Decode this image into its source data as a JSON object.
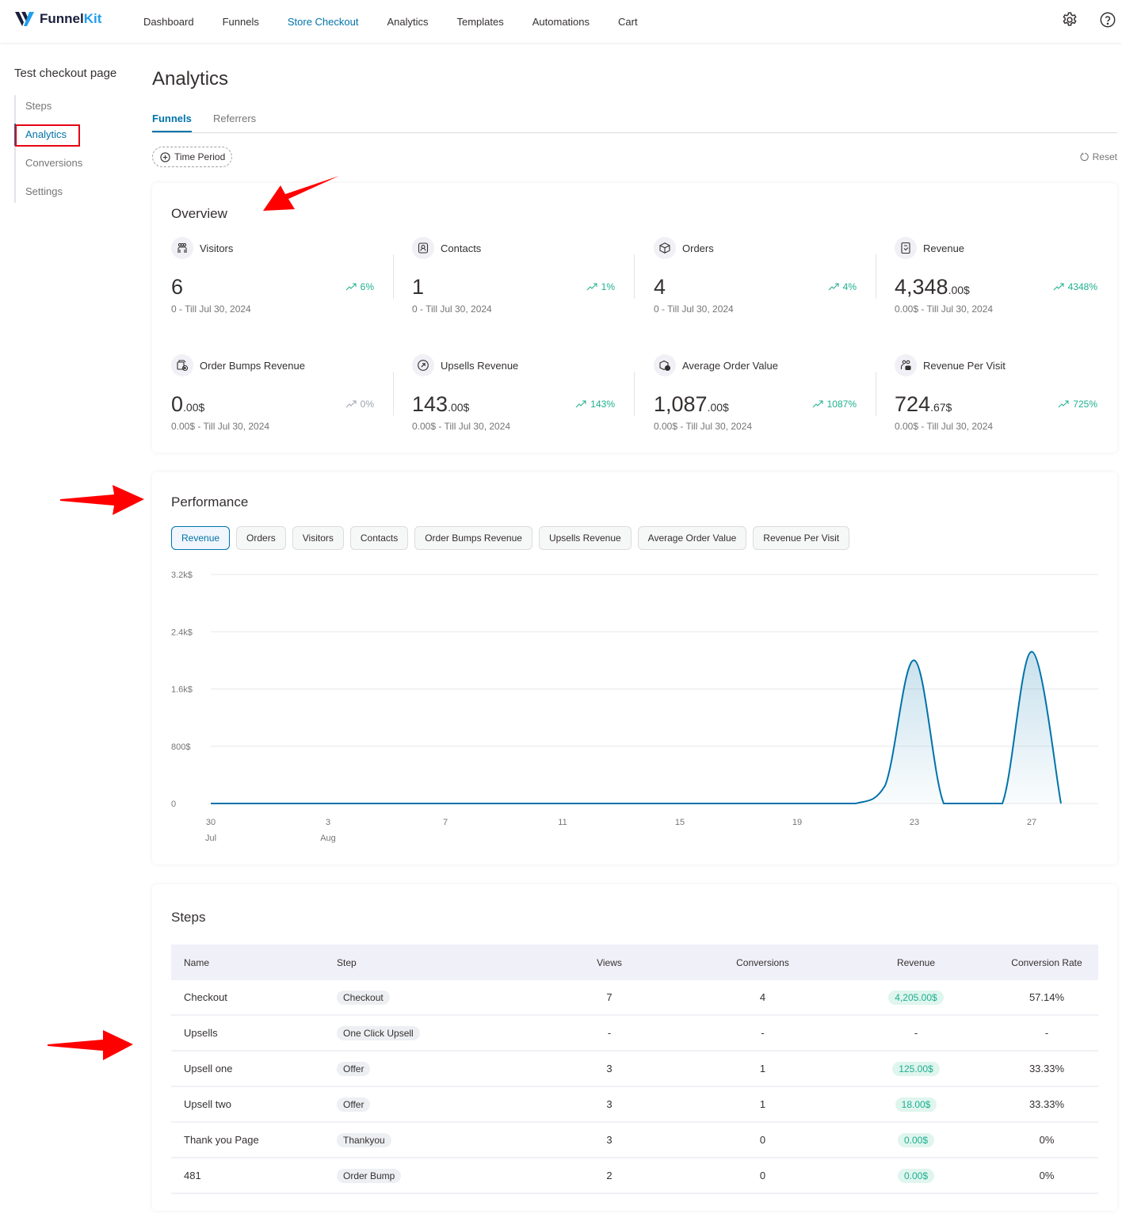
{
  "app": {
    "brand_part1": "Funnel",
    "brand_part2": "Kit",
    "nav": [
      {
        "label": "Dashboard",
        "active": false
      },
      {
        "label": "Funnels",
        "active": false
      },
      {
        "label": "Store Checkout",
        "active": true
      },
      {
        "label": "Analytics",
        "active": false
      },
      {
        "label": "Templates",
        "active": false
      },
      {
        "label": "Automations",
        "active": false
      },
      {
        "label": "Cart",
        "active": false
      }
    ],
    "icons": [
      "gear-icon",
      "help-icon"
    ]
  },
  "sidebar": {
    "title": "Test checkout page",
    "items": [
      {
        "label": "Steps",
        "active": false
      },
      {
        "label": "Analytics",
        "active": true
      },
      {
        "label": "Conversions",
        "active": false
      },
      {
        "label": "Settings",
        "active": false
      }
    ]
  },
  "main": {
    "title": "Analytics",
    "tabs": [
      {
        "label": "Funnels",
        "active": true
      },
      {
        "label": "Referrers",
        "active": false
      }
    ],
    "time_period_label": "Time Period",
    "reset_label": "Reset"
  },
  "overview": {
    "title": "Overview",
    "metrics": [
      {
        "label": "Visitors",
        "icon": "visitors-icon",
        "value": "6",
        "decimal": "",
        "change": "6%",
        "trend": "up",
        "sub": "0 - Till Jul 30, 2024"
      },
      {
        "label": "Contacts",
        "icon": "contacts-icon",
        "value": "1",
        "decimal": "",
        "change": "1%",
        "trend": "up",
        "sub": "0 - Till Jul 30, 2024"
      },
      {
        "label": "Orders",
        "icon": "orders-icon",
        "value": "4",
        "decimal": "",
        "change": "4%",
        "trend": "up",
        "sub": "0 - Till Jul 30, 2024"
      },
      {
        "label": "Revenue",
        "icon": "revenue-icon",
        "value": "4,348",
        "decimal": ".00$",
        "change": "4348%",
        "trend": "up",
        "sub": "0.00$ - Till Jul 30, 2024"
      },
      {
        "label": "Order Bumps Revenue",
        "icon": "order-bumps-icon",
        "value": "0",
        "decimal": ".00$",
        "change": "0%",
        "trend": "neutral",
        "sub": "0.00$ - Till Jul 30, 2024"
      },
      {
        "label": "Upsells Revenue",
        "icon": "upsells-icon",
        "value": "143",
        "decimal": ".00$",
        "change": "143%",
        "trend": "up",
        "sub": "0.00$ - Till Jul 30, 2024"
      },
      {
        "label": "Average Order Value",
        "icon": "aov-icon",
        "value": "1,087",
        "decimal": ".00$",
        "change": "1087%",
        "trend": "up",
        "sub": "0.00$ - Till Jul 30, 2024"
      },
      {
        "label": "Revenue Per Visit",
        "icon": "revenue-per-visit-icon",
        "value": "724",
        "decimal": ".67$",
        "change": "725%",
        "trend": "up",
        "sub": "0.00$ - Till Jul 30, 2024"
      }
    ]
  },
  "performance": {
    "title": "Performance",
    "chips": [
      {
        "label": "Revenue",
        "active": true
      },
      {
        "label": "Orders",
        "active": false
      },
      {
        "label": "Visitors",
        "active": false
      },
      {
        "label": "Contacts",
        "active": false
      },
      {
        "label": "Order Bumps Revenue",
        "active": false
      },
      {
        "label": "Upsells Revenue",
        "active": false
      },
      {
        "label": "Average Order Value",
        "active": false
      },
      {
        "label": "Revenue Per Visit",
        "active": false
      }
    ]
  },
  "chart_data": {
    "type": "area",
    "title": "",
    "xlabel": "",
    "ylabel": "",
    "series": [
      {
        "name": "Revenue",
        "color": "#0073aa",
        "x": [
          "Jul 30",
          "Jul 31",
          "Aug 1",
          "Aug 2",
          "Aug 3",
          "Aug 4",
          "Aug 5",
          "Aug 6",
          "Aug 7",
          "Aug 8",
          "Aug 9",
          "Aug 10",
          "Aug 11",
          "Aug 12",
          "Aug 13",
          "Aug 14",
          "Aug 15",
          "Aug 16",
          "Aug 17",
          "Aug 18",
          "Aug 19",
          "Aug 20",
          "Aug 21",
          "Aug 22",
          "Aug 23",
          "Aug 24",
          "Aug 25",
          "Aug 26",
          "Aug 27",
          "Aug 28"
        ],
        "values": [
          0,
          0,
          0,
          0,
          0,
          0,
          0,
          0,
          0,
          0,
          0,
          0,
          0,
          0,
          0,
          0,
          0,
          0,
          0,
          0,
          0,
          0,
          0,
          250,
          2000,
          0,
          0,
          0,
          2120,
          0
        ]
      }
    ],
    "x_ticks": [
      {
        "index": 0,
        "label": "30",
        "sub": "Jul"
      },
      {
        "index": 4,
        "label": "3",
        "sub": "Aug"
      },
      {
        "index": 8,
        "label": "7",
        "sub": ""
      },
      {
        "index": 12,
        "label": "11",
        "sub": ""
      },
      {
        "index": 16,
        "label": "15",
        "sub": ""
      },
      {
        "index": 20,
        "label": "19",
        "sub": ""
      },
      {
        "index": 24,
        "label": "23",
        "sub": ""
      },
      {
        "index": 28,
        "label": "27",
        "sub": ""
      }
    ],
    "y_ticks": [
      {
        "value": 0,
        "label": "0"
      },
      {
        "value": 800,
        "label": "800$"
      },
      {
        "value": 1600,
        "label": "1.6k$"
      },
      {
        "value": 2400,
        "label": "2.4k$"
      },
      {
        "value": 3200,
        "label": "3.2k$"
      }
    ],
    "ylim": [
      0,
      3200
    ],
    "grid": true,
    "legend": "none"
  },
  "steps": {
    "title": "Steps",
    "columns": [
      "Name",
      "Step",
      "Views",
      "Conversions",
      "Revenue",
      "Conversion Rate"
    ],
    "rows": [
      {
        "name": "Checkout",
        "step": "Checkout",
        "views": "7",
        "conversions": "4",
        "revenue": "4,205.00$",
        "rate": "57.14%"
      },
      {
        "name": "Upsells",
        "step": "One Click Upsell",
        "views": "-",
        "conversions": "-",
        "revenue": "-",
        "rate": "-"
      },
      {
        "name": "Upsell one",
        "step": "Offer",
        "views": "3",
        "conversions": "1",
        "revenue": "125.00$",
        "rate": "33.33%"
      },
      {
        "name": "Upsell two",
        "step": "Offer",
        "views": "3",
        "conversions": "1",
        "revenue": "18.00$",
        "rate": "33.33%"
      },
      {
        "name": "Thank you Page",
        "step": "Thankyou",
        "views": "3",
        "conversions": "0",
        "revenue": "0.00$",
        "rate": "0%"
      },
      {
        "name": "481",
        "step": "Order Bump",
        "views": "2",
        "conversions": "0",
        "revenue": "0.00$",
        "rate": "0%"
      }
    ]
  },
  "colors": {
    "accent": "#0073aa",
    "positive": "#1daf8f",
    "annotation": "#e60012"
  }
}
